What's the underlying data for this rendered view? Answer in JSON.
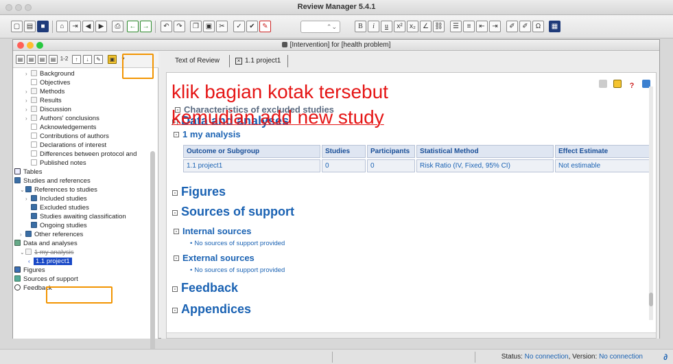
{
  "app": {
    "title": "Review Manager 5.4.1"
  },
  "toolbar": {
    "buttons": [
      "new-doc",
      "open",
      "save",
      "home",
      "import",
      "nav-back",
      "nav-forward",
      "print",
      "go-back",
      "go-forward",
      "undo",
      "redo",
      "copy",
      "paste",
      "cut",
      "spell-check",
      "spell-options",
      "highlight",
      "font-size",
      "bold",
      "italic",
      "underline",
      "superscript",
      "subscript",
      "special-character",
      "insert-link",
      "bulleted-list",
      "numbered-list",
      "decrease-indent",
      "increase-indent",
      "track-changes",
      "accept-changes",
      "omega",
      "table"
    ],
    "font_size_value": "",
    "bold": "B",
    "italic": "i",
    "underline": "u",
    "omega": "Ω"
  },
  "window": {
    "title": "[Intervention] for [health problem]"
  },
  "tree": {
    "items": [
      {
        "label": "Background",
        "icon": "section-icon"
      },
      {
        "label": "Objectives",
        "icon": "doc-icon"
      },
      {
        "label": "Methods",
        "icon": "section-icon"
      },
      {
        "label": "Results",
        "icon": "section-icon"
      },
      {
        "label": "Discussion",
        "icon": "section-icon"
      },
      {
        "label": "Authors' conclusions",
        "icon": "section-icon"
      },
      {
        "label": "Acknowledgements",
        "icon": "doc-icon"
      },
      {
        "label": "Contributions of authors",
        "icon": "doc-icon"
      },
      {
        "label": "Declarations of interest",
        "icon": "doc-icon"
      },
      {
        "label": "Differences between protocol and",
        "icon": "doc-icon"
      },
      {
        "label": "Published notes",
        "icon": "doc-icon"
      },
      {
        "label": "Tables",
        "icon": "table-icon"
      },
      {
        "label": "Studies and references",
        "icon": "studies-icon"
      },
      {
        "label": "References to studies",
        "icon": "references-icon"
      },
      {
        "label": "Included studies",
        "icon": "study-icon"
      },
      {
        "label": "Excluded studies",
        "icon": "study-icon"
      },
      {
        "label": "Studies awaiting classification",
        "icon": "study-icon"
      },
      {
        "label": "Ongoing studies",
        "icon": "study-icon"
      },
      {
        "label": "Other references",
        "icon": "references-icon"
      },
      {
        "label": "Data and analyses",
        "icon": "data-icon"
      },
      {
        "label": "1 my analysis",
        "icon": "analysis-icon"
      },
      {
        "label": "1.1 project1",
        "icon": "outcome-icon"
      },
      {
        "label": "Figures",
        "icon": "figures-icon"
      },
      {
        "label": "Sources of support",
        "icon": "support-icon"
      },
      {
        "label": "Feedback",
        "icon": "feedback-icon"
      }
    ]
  },
  "tabs": {
    "text_of_review": "Text of Review",
    "project_tab": "1.1 project1"
  },
  "content": {
    "characteristics_heading": "Characteristics of excluded studies",
    "data_heading": "Data and analyses",
    "analysis_heading": "1 my analysis",
    "table": {
      "headers": [
        "Outcome or Subgroup",
        "Studies",
        "Participants",
        "Statistical Method",
        "Effect Estimate"
      ],
      "rows": [
        [
          "1.1 project1",
          "0",
          "0",
          "Risk Ratio (IV, Fixed, 95% CI)",
          "Not estimable"
        ]
      ]
    },
    "figures_heading": "Figures",
    "sources_heading": "Sources of support",
    "internal_heading": "Internal sources",
    "internal_note": "No sources of support provided",
    "external_heading": "External sources",
    "external_note": "No sources of support provided",
    "feedback_heading": "Feedback",
    "appendices_heading": "Appendices"
  },
  "annotations": {
    "line1": "klik bagian kotak tersebut",
    "line2": "kemudian add new study",
    "color": "#e51515",
    "box_color": "#f29400"
  },
  "status": {
    "label": "Status:",
    "status_value": "No connection",
    "version_label": "Version:",
    "version_value": "No connection"
  }
}
